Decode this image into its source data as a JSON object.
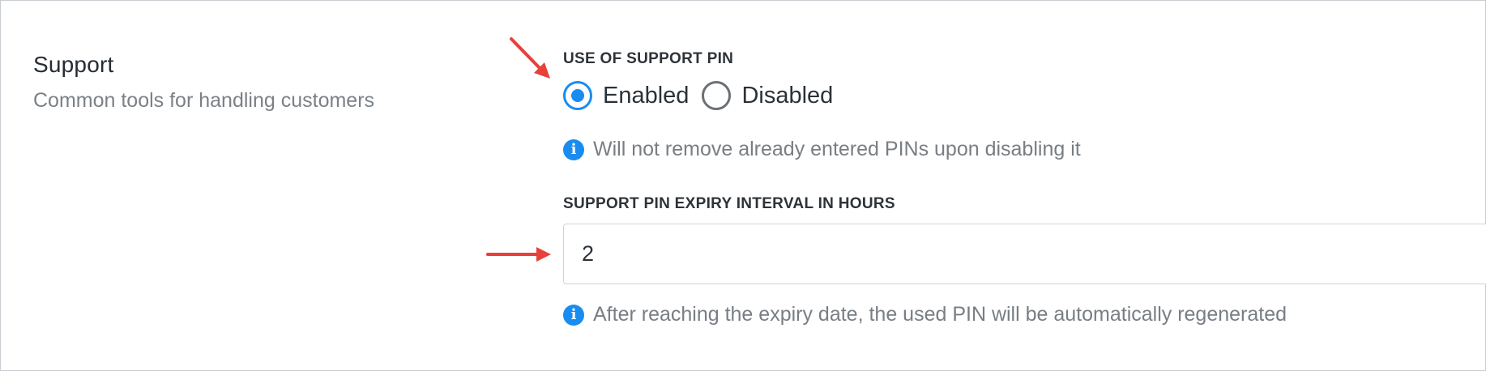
{
  "section": {
    "title": "Support",
    "description": "Common tools for handling customers"
  },
  "support_pin": {
    "label": "USE OF SUPPORT PIN",
    "options": [
      {
        "label": "Enabled",
        "selected": true
      },
      {
        "label": "Disabled",
        "selected": false
      }
    ],
    "hint": "Will not remove already entered PINs upon disabling it"
  },
  "expiry": {
    "label": "SUPPORT PIN EXPIRY INTERVAL IN HOURS",
    "value": "2",
    "hint": "After reaching the expiry date, the used PIN will be automatically regenerated"
  },
  "icons": {
    "info": "info-circle-icon",
    "annotation": "red-arrow-annotation"
  },
  "colors": {
    "accent": "#1a8cf0",
    "annotation": "#e8403a",
    "label": "#2e3338",
    "muted": "#787e84"
  }
}
